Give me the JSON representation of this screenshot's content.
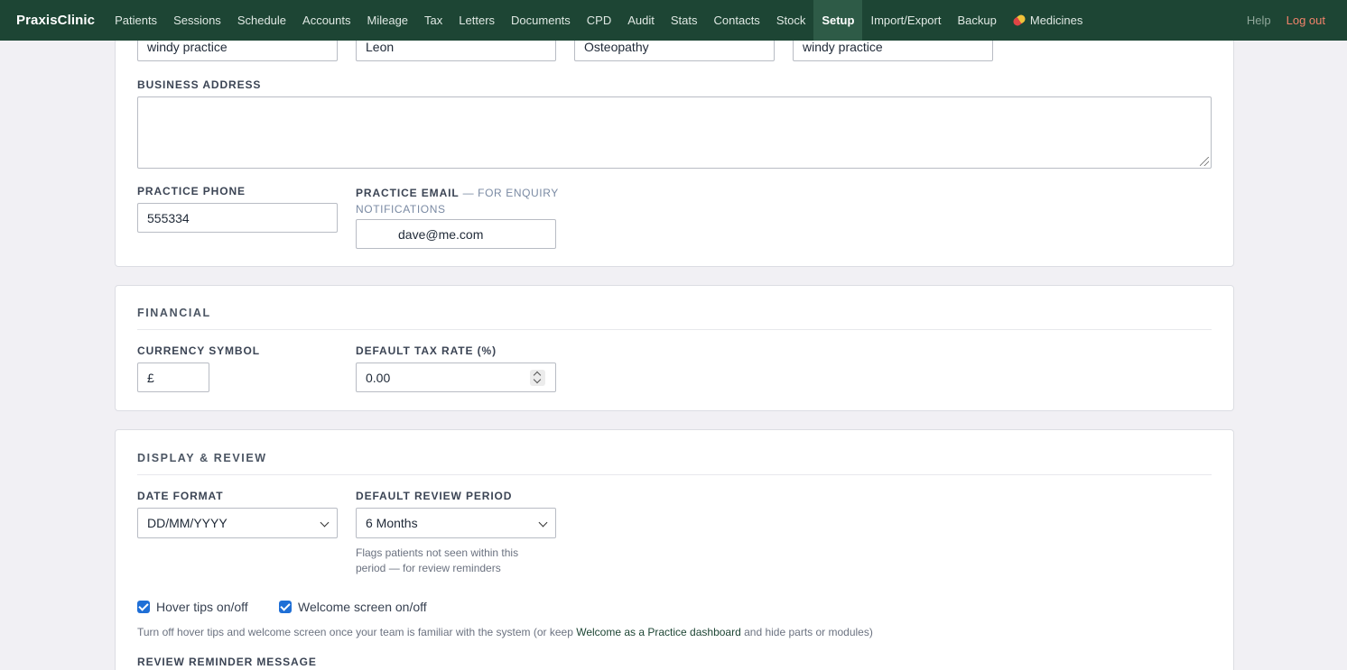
{
  "app": {
    "brand": "PraxisClinic"
  },
  "nav": {
    "items": [
      "Patients",
      "Sessions",
      "Schedule",
      "Accounts",
      "Mileage",
      "Tax",
      "Letters",
      "Documents",
      "CPD",
      "Audit",
      "Stats",
      "Contacts",
      "Stock",
      "Setup",
      "Import/Export",
      "Backup",
      "Medicines"
    ],
    "active": "Setup",
    "help": "Help",
    "logout": "Log out"
  },
  "practice": {
    "top_fields": [
      "windy practice",
      "Leon",
      "Osteopathy",
      "windy practice"
    ],
    "business_address_label": "Business Address",
    "business_address_value": "",
    "phone_label": "Practice Phone",
    "phone_value": "555334",
    "email_label": "Practice Email",
    "email_hint": "— for enquiry notifications",
    "email_value": "dave@me.com"
  },
  "financial": {
    "title": "Financial",
    "currency_label": "Currency Symbol",
    "currency_value": "£",
    "tax_label": "Default Tax Rate (%)",
    "tax_value": "0.00"
  },
  "display": {
    "title": "Display & Review",
    "date_format_label": "Date Format",
    "date_format_value": "DD/MM/YYYY",
    "review_period_label": "Default Review Period",
    "review_period_value": "6 Months",
    "review_help": "Flags patients not seen within this period — for review reminders",
    "hover_tips_label": "Hover tips on/off",
    "hover_tips_checked": true,
    "welcome_label": "Welcome screen on/off",
    "welcome_checked": true,
    "note_before": "Turn off hover tips and welcome screen once your team is familiar with the system (or keep ",
    "note_link": "Welcome as a Practice dashboard",
    "note_after": " and hide parts or modules)",
    "review_message_label": "Review Reminder Message"
  },
  "colors": {
    "nav_bg": "#1d4534",
    "active_nav": "#2e5b47",
    "logout": "#f2836b",
    "checkbox": "#1f6fd6"
  }
}
